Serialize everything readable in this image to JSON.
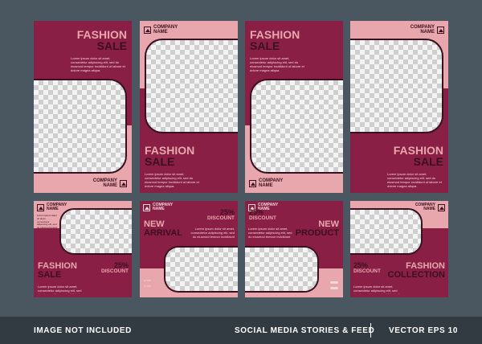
{
  "templates": {
    "fashion": "FASHION",
    "sale": "SALE",
    "new": "NEW",
    "arrival": "ARRIVAL",
    "product": "PRODUCT",
    "collection": "COLLECTION",
    "company_line1": "COMPANY",
    "company_line2": "NAME",
    "discount_pct": "25%",
    "discount_label": "DISCOUNT",
    "lorem": "Lorem ipsum dolor sit amet, consectetur adipiscing elit, sed do eiusmod tempor incididunt ut labore et dolore magna aliqua."
  },
  "footer": {
    "left": "IMAGE NOT INCLUDED",
    "center": "SOCIAL MEDIA STORIES & FEED",
    "right": "VECTOR EPS 10"
  },
  "colors": {
    "maroon": "#8a1f45",
    "pink": "#e8a6ad",
    "dark": "#3a1020",
    "background": "#4a5660"
  }
}
